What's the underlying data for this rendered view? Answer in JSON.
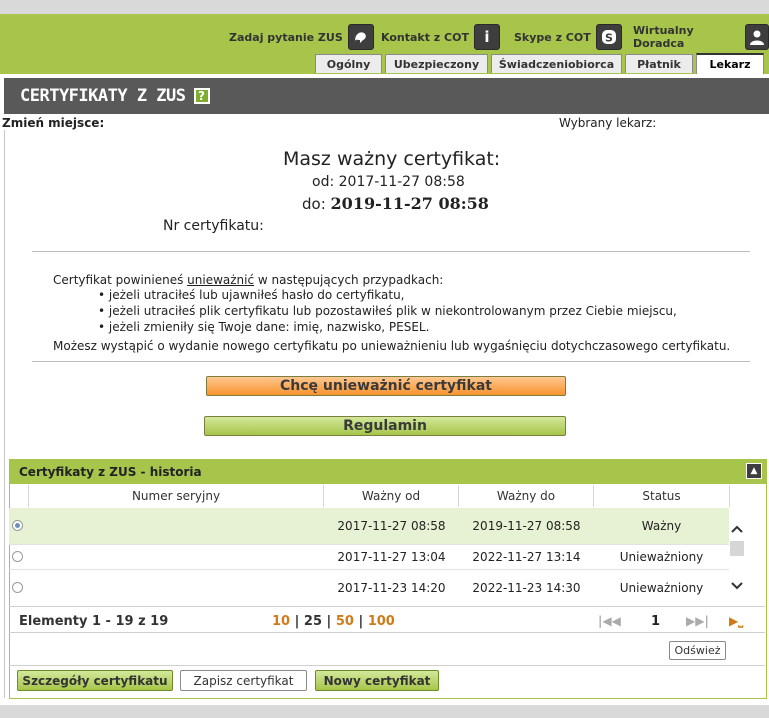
{
  "header": {
    "links": [
      {
        "label": "Zadaj pytanie ZUS",
        "icon": "chat-icon"
      },
      {
        "label": "Kontakt z COT",
        "icon": "info-icon"
      },
      {
        "label": "Skype z COT",
        "icon": "skype-icon"
      },
      {
        "label": "Wirtualny Doradca",
        "icon": "user-icon"
      }
    ],
    "tabs": [
      "Ogólny",
      "Ubezpieczony",
      "Świadczeniobiorca",
      "Płatnik",
      "Lekarz"
    ],
    "active_tab": "Lekarz"
  },
  "page": {
    "title": "CERTYFIKATY Z ZUS",
    "help": "?",
    "change_place_label": "Zmień miejsce:",
    "selected_doctor_label": "Wybrany lekarz:"
  },
  "certificate": {
    "heading": "Masz ważny certyfikat:",
    "from_label": "od:",
    "from_value": "2017-11-27 08:58",
    "to_label": "do:",
    "to_value": "2019-11-27 08:58",
    "number_label": "Nr certyfikatu:"
  },
  "info": {
    "intro_pre": "Certyfikat powinieneś ",
    "intro_link": "unieważnić",
    "intro_post": " w następujących przypadkach:",
    "bullets": [
      "jeżeli utraciłeś lub ujawniłeś hasło do certyfikatu,",
      "jeżeli utraciłeś plik certyfikatu lub pozostawiłeś plik w niekontrolowanym przez Ciebie miejscu,",
      "jeżeli zmieniły się Twoje dane: imię, nazwisko, PESEL."
    ],
    "outro": "Możesz wystąpić o wydanie nowego certyfikatu po unieważnieniu lub wygaśnięciu dotychczasowego certyfikatu."
  },
  "buttons": {
    "revoke": "Chcę unieważnić certyfikat",
    "terms": "Regulamin"
  },
  "history": {
    "title": "Certyfikaty z ZUS - historia",
    "columns": [
      "Numer seryjny",
      "Ważny od",
      "Ważny do",
      "Status"
    ],
    "rows": [
      {
        "serial": "",
        "from": "2017-11-27 08:58",
        "to": "2019-11-27 08:58",
        "status": "Ważny",
        "selected": true
      },
      {
        "serial": "",
        "from": "2017-11-27 13:04",
        "to": "2022-11-27 13:14",
        "status": "Unieważniony",
        "selected": false
      },
      {
        "serial": "",
        "from": "2017-11-23 14:20",
        "to": "2022-11-23 14:30",
        "status": "Unieważniony",
        "selected": false
      }
    ],
    "elements_label": "Elementy 1 - 19 z 19",
    "page_sizes": [
      "10",
      "25",
      "50",
      "100"
    ],
    "current_page": "1",
    "refresh": "Odśwież",
    "details": "Szczegóły certyfikatu",
    "save": "Zapisz certyfikat",
    "new": "Nowy certyfikat"
  },
  "colors": {
    "brand_green": "#a6c54a",
    "title_bar": "#595959",
    "orange": "#f7932e"
  }
}
